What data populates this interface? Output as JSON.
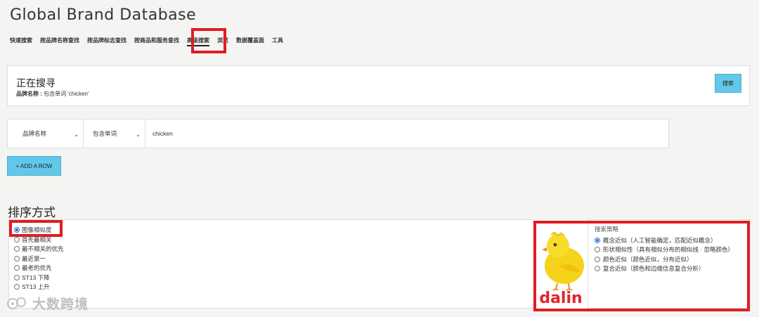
{
  "app": {
    "title": "Global Brand Database"
  },
  "tabs": [
    "快速搜索",
    "按品牌名称查找",
    "按品牌标志查找",
    "按商品和服务查找",
    "高级搜索",
    "浏览",
    "数据覆盖面",
    "工具"
  ],
  "search_panel": {
    "heading": "正在搜寻",
    "criteria_label": "品牌名称 :",
    "criteria_value": "包含单词 'chicken'",
    "search_button": "搜索"
  },
  "query_row": {
    "field": "品牌名称",
    "operator": "包含单词",
    "value": "chicken"
  },
  "add_row_button": "+ ADD A ROW",
  "sort": {
    "title": "排序方式",
    "options": [
      {
        "label": "图像相似度",
        "selected": true
      },
      {
        "label": "首先最相关",
        "selected": false
      },
      {
        "label": "最不相关的优先",
        "selected": false
      },
      {
        "label": "最近第一",
        "selected": false
      },
      {
        "label": "最老的优先",
        "selected": false
      },
      {
        "label": "ST13 下降",
        "selected": false
      },
      {
        "label": "ST13 上升",
        "selected": false
      }
    ]
  },
  "image_search": {
    "logo_text": "dalin",
    "strategy_label": "搜索策略",
    "strategies": [
      {
        "label": "概念近似（人工智能确定，匹配近似概念）",
        "selected": true
      },
      {
        "label": "形状相似性（具有相似分布的相似线 · 忽略颜色）",
        "selected": false
      },
      {
        "label": "颜色近似（颜色近似，分布近似）",
        "selected": false
      },
      {
        "label": "复合近似（颜色和边缘信息复合分析）",
        "selected": false
      }
    ]
  },
  "watermark": "大数跨境",
  "colors": {
    "accent_button": "#62c8ea",
    "highlight_box": "#e01c24",
    "radio_selected": "#2a6fd6",
    "logo_red": "#e3242b"
  }
}
